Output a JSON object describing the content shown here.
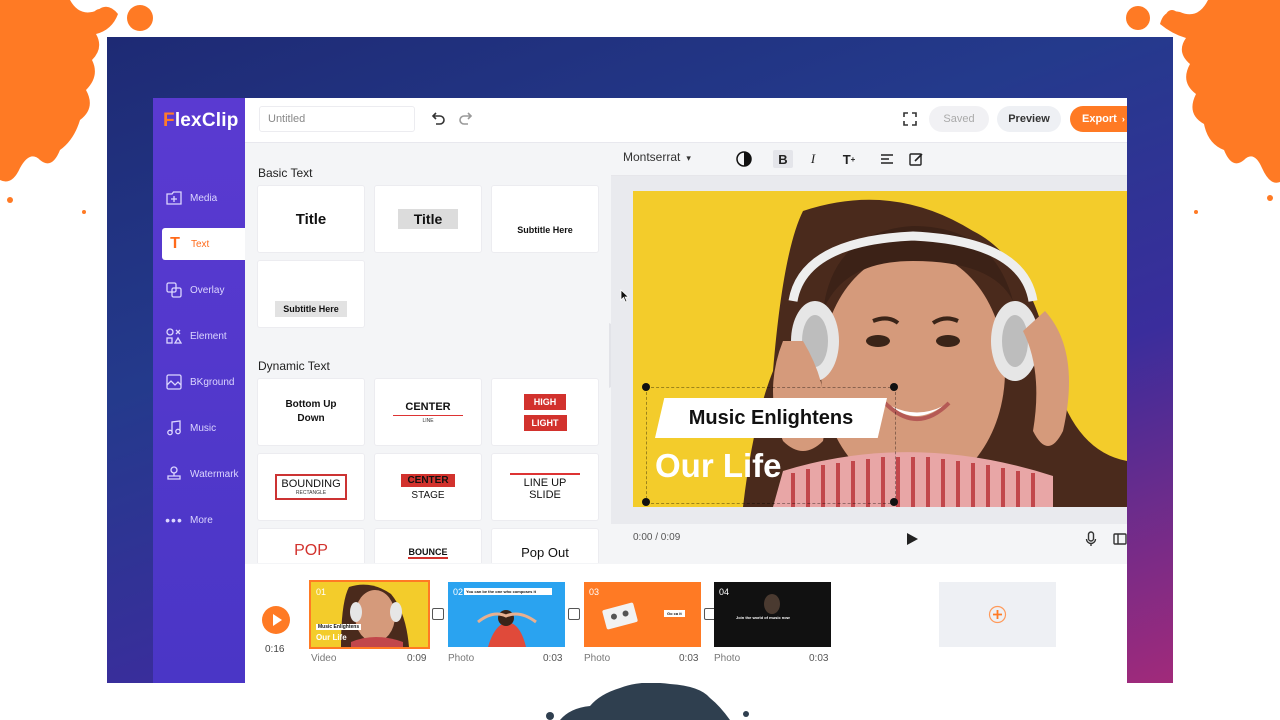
{
  "app": {
    "logo_initial": "F",
    "logo_rest": "lexClip"
  },
  "topbar": {
    "title_value": "Untitled",
    "saved_label": "Saved",
    "preview_label": "Preview",
    "export_label": "Export"
  },
  "sidebar": {
    "items": [
      {
        "label": "Media",
        "icon": "media-icon"
      },
      {
        "label": "Text",
        "icon": "text-icon",
        "active": true
      },
      {
        "label": "Overlay",
        "icon": "overlay-icon"
      },
      {
        "label": "Element",
        "icon": "element-icon"
      },
      {
        "label": "BKground",
        "icon": "background-icon"
      },
      {
        "label": "Music",
        "icon": "music-icon"
      },
      {
        "label": "Watermark",
        "icon": "watermark-icon"
      },
      {
        "label": "More",
        "icon": "more-icon"
      }
    ]
  },
  "panel": {
    "basic_heading": "Basic Text",
    "basic": [
      "Title",
      "Title",
      "Subtitle Here",
      "Subtitle Here"
    ],
    "dynamic_heading": "Dynamic Text",
    "dynamic": {
      "bottom_up": "Bottom Up Down",
      "center": "CENTER",
      "center_sub": "LINE",
      "high": "HIGH",
      "light": "LIGHT",
      "bounding": "BOUNDING",
      "bounding_sub": "RECTANGLE",
      "center_stage_top": "CENTER",
      "center_stage_bottom": "STAGE",
      "line_up_1": "LINE UP",
      "line_up_2": "SLIDE",
      "pop": "POP",
      "bounce": "BOUNCE",
      "pop_out": "Pop Out"
    }
  },
  "toolbar": {
    "font": "Montserrat"
  },
  "canvas": {
    "headline": "Music Enlightens",
    "subline": "Our Life",
    "time": "0:00 / 0:09"
  },
  "timeline": {
    "total": "0:16",
    "clips": [
      {
        "num": "01",
        "type": "Video",
        "duration": "0:09",
        "caption1": "Music Enlightens",
        "caption2": "Our Life"
      },
      {
        "num": "02",
        "type": "Photo",
        "duration": "0:03",
        "caption1": "You can be the one who composes it"
      },
      {
        "num": "03",
        "type": "Photo",
        "duration": "0:03",
        "caption1": "Go ca it"
      },
      {
        "num": "04",
        "type": "Photo",
        "duration": "0:03",
        "caption1": "Join the world of music now"
      }
    ]
  },
  "colors": {
    "accent": "#ff7a24",
    "sidebar": "#5038c8",
    "canvas_bg": "#f3cc2b"
  }
}
